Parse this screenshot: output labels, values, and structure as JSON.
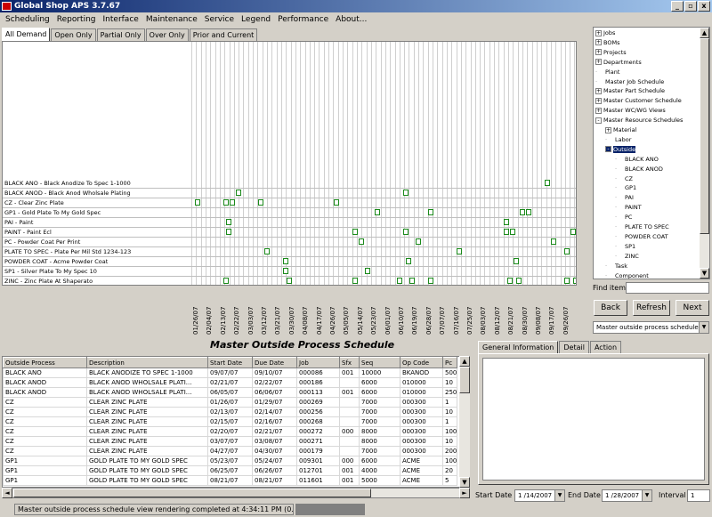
{
  "window": {
    "title": "Global Shop APS 3.7.67",
    "min": "_",
    "max": "▫",
    "close": "x"
  },
  "menu": [
    "Scheduling",
    "Reporting",
    "Interface",
    "Maintenance",
    "Service",
    "Legend",
    "Performance",
    "About..."
  ],
  "view_tabs": [
    "All Demand",
    "Open Only",
    "Partial Only",
    "Over Only",
    "Prior and Current"
  ],
  "gantt": {
    "resources": [
      "BLACK ANO - Black Anodize To Spec 1-1000",
      "BLACK ANOD - Black Anod Wholsale Plating",
      "CZ - Clear Zinc Plate",
      "GP1 - Gold Plate To My Gold Spec",
      "PAI - Paint",
      "PAINT - Paint Ecl",
      "PC - Powder Coat Per Print",
      "PLATE TO SPEC - Plate Per Mil Std 1234-123",
      "POWDER COAT - Acme Powder Coat",
      "SP1 - Silver Plate To My Spec 10",
      "ZINC - Zinc Plate At Shaperato"
    ],
    "dates": [
      "01/26/07",
      "02/04/07",
      "02/13/07",
      "02/22/07",
      "03/03/07",
      "03/12/07",
      "03/21/07",
      "03/30/07",
      "04/08/07",
      "04/17/07",
      "04/26/07",
      "05/05/07",
      "05/14/07",
      "05/23/07",
      "06/01/07",
      "06/10/07",
      "06/19/07",
      "06/28/07",
      "07/07/07",
      "07/16/07",
      "07/25/07",
      "08/03/07",
      "08/12/07",
      "08/21/07",
      "08/30/07",
      "09/08/07",
      "09/17/07",
      "09/26/07"
    ],
    "bar_colour": "#1a8a1a"
  },
  "schedule": {
    "title": "Master Outside Process Schedule",
    "columns": [
      "Outside Process",
      "Description",
      "Start Date",
      "Due Date",
      "Job",
      "Sfx",
      "Seq",
      "Op Code",
      "Pc"
    ],
    "rows": [
      [
        "BLACK ANO",
        "BLACK ANODIZE TO SPEC 1-1000",
        "09/07/07",
        "09/10/07",
        "000086",
        "001",
        "10000",
        "BKANOD",
        "500"
      ],
      [
        "BLACK ANOD",
        "BLACK ANOD WHOLSALE PLATI...",
        "02/21/07",
        "02/22/07",
        "000186",
        "",
        "6000",
        "010000",
        "10"
      ],
      [
        "BLACK ANOD",
        "BLACK ANOD WHOLSALE PLATI...",
        "06/05/07",
        "06/06/07",
        "000113",
        "001",
        "6000",
        "010000",
        "250"
      ],
      [
        "CZ",
        "CLEAR ZINC PLATE",
        "01/26/07",
        "01/29/07",
        "000269",
        "",
        "7000",
        "000300",
        "1"
      ],
      [
        "CZ",
        "CLEAR ZINC PLATE",
        "02/13/07",
        "02/14/07",
        "000256",
        "",
        "7000",
        "000300",
        "10"
      ],
      [
        "CZ",
        "CLEAR ZINC PLATE",
        "02/15/07",
        "02/16/07",
        "000268",
        "",
        "7000",
        "000300",
        "1"
      ],
      [
        "CZ",
        "CLEAR ZINC PLATE",
        "02/20/07",
        "02/21/07",
        "000272",
        "000",
        "8000",
        "000300",
        "100"
      ],
      [
        "CZ",
        "CLEAR ZINC PLATE",
        "03/07/07",
        "03/08/07",
        "000271",
        "",
        "8000",
        "000300",
        "10"
      ],
      [
        "CZ",
        "CLEAR ZINC PLATE",
        "04/27/07",
        "04/30/07",
        "000179",
        "",
        "7000",
        "000300",
        "200"
      ],
      [
        "GP1",
        "GOLD PLATE TO MY GOLD SPEC",
        "05/23/07",
        "05/24/07",
        "009301",
        "000",
        "6000",
        "ACME",
        "100"
      ],
      [
        "GP1",
        "GOLD PLATE TO MY GOLD SPEC",
        "06/25/07",
        "06/26/07",
        "012701",
        "001",
        "4000",
        "ACME",
        "20"
      ],
      [
        "GP1",
        "GOLD PLATE TO MY GOLD SPEC",
        "08/21/07",
        "08/21/07",
        "011601",
        "001",
        "5000",
        "ACME",
        "5"
      ]
    ]
  },
  "tree": {
    "nodes": [
      {
        "label": "Jobs",
        "level": 0,
        "exp": "+"
      },
      {
        "label": "BOMs",
        "level": 0,
        "exp": "+"
      },
      {
        "label": "Projects",
        "level": 0,
        "exp": "+"
      },
      {
        "label": "Departments",
        "level": 0,
        "exp": "+"
      },
      {
        "label": "Plant",
        "level": 0,
        "exp": ""
      },
      {
        "label": "Master Job Schedule",
        "level": 0,
        "exp": ""
      },
      {
        "label": "Master Part Schedule",
        "level": 0,
        "exp": "+"
      },
      {
        "label": "Master Customer Schedule",
        "level": 0,
        "exp": "+"
      },
      {
        "label": "Master WC/WG Views",
        "level": 0,
        "exp": "+"
      },
      {
        "label": "Master Resource Schedules",
        "level": 0,
        "exp": "-"
      },
      {
        "label": "Material",
        "level": 1,
        "exp": "+"
      },
      {
        "label": "Labor",
        "level": 1,
        "exp": ""
      },
      {
        "label": "Outside",
        "level": 1,
        "exp": "-",
        "selected": true
      },
      {
        "label": "BLACK ANO",
        "level": 2,
        "exp": ""
      },
      {
        "label": "BLACK ANOD",
        "level": 2,
        "exp": ""
      },
      {
        "label": "CZ",
        "level": 2,
        "exp": ""
      },
      {
        "label": "GP1",
        "level": 2,
        "exp": ""
      },
      {
        "label": "PAI",
        "level": 2,
        "exp": ""
      },
      {
        "label": "PAINT",
        "level": 2,
        "exp": ""
      },
      {
        "label": "PC",
        "level": 2,
        "exp": ""
      },
      {
        "label": "PLATE TO SPEC",
        "level": 2,
        "exp": ""
      },
      {
        "label": "POWDER COAT",
        "level": 2,
        "exp": ""
      },
      {
        "label": "SP1",
        "level": 2,
        "exp": ""
      },
      {
        "label": "ZINC",
        "level": 2,
        "exp": ""
      },
      {
        "label": "Task",
        "level": 1,
        "exp": ""
      },
      {
        "label": "Component",
        "level": 1,
        "exp": ""
      }
    ]
  },
  "find": {
    "label": "Find item",
    "value": ""
  },
  "nav": {
    "back": "Back",
    "refresh": "Refresh",
    "next": "Next"
  },
  "view_select": "Master outside process schedule",
  "detail_tabs": [
    "General Information",
    "Detail",
    "Action"
  ],
  "bottom": {
    "start_label": "Start Date",
    "start_value": "1 /14/2007",
    "end_label": "End Date",
    "end_value": "1 /28/2007",
    "interval_label": "Interval",
    "interval_value": "1"
  },
  "status": {
    "text": "Master outside process schedule view rendering completed at 4:34:11 PM  (0.00 r"
  }
}
